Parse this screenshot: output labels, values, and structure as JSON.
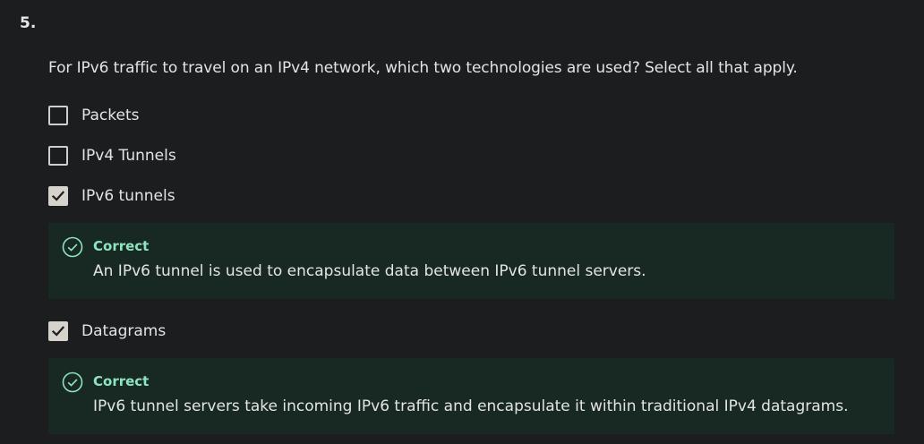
{
  "question": {
    "number": "5.",
    "text": "For IPv6 traffic to travel on an IPv4 network, which two technologies are used? Select all that apply."
  },
  "options": [
    {
      "label": "Packets",
      "checked": false
    },
    {
      "label": "IPv4 Tunnels",
      "checked": false
    },
    {
      "label": "IPv6 tunnels",
      "checked": true
    },
    {
      "label": "Datagrams",
      "checked": true
    }
  ],
  "feedback": [
    {
      "status": "Correct",
      "text": "An IPv6 tunnel is used to encapsulate data between IPv6 tunnel servers."
    },
    {
      "status": "Correct",
      "text": "IPv6 tunnel servers take incoming IPv6 traffic and encapsulate it within traditional IPv4 datagrams."
    }
  ],
  "colors": {
    "background": "#1c1d1f",
    "feedback_bg": "#172922",
    "correct_green": "#8ee3c2",
    "checkbox_checked": "#d6d3cd"
  },
  "icons": {
    "checkbox_check": "check-icon",
    "feedback": "check-circle-icon"
  }
}
